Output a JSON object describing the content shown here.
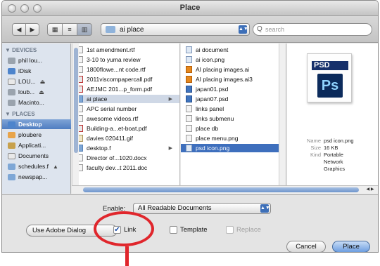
{
  "window": {
    "title": "Place"
  },
  "toolbar": {
    "back_glyph": "◀",
    "forward_glyph": "▶",
    "view_icon_glyph": "▦",
    "view_list_glyph": "≡",
    "view_column_glyph": "▥",
    "path_label": "ai place",
    "search_placeholder": "search",
    "search_glyph": "Q"
  },
  "sidebar": {
    "devices_heading": "▼ DEVICES",
    "places_heading": "▼ PLACES",
    "devices": [
      {
        "label": "phil lou...",
        "icon": "hard-drive-icon",
        "eject": ""
      },
      {
        "label": "iDisk",
        "icon": "idisk-icon",
        "eject": ""
      },
      {
        "label": "LOU...",
        "icon": "drive-icon",
        "eject": "⏏"
      },
      {
        "label": "loub...",
        "icon": "drive-icon",
        "eject": "⏏"
      },
      {
        "label": "Macinto...",
        "icon": "hard-drive-icon",
        "eject": ""
      }
    ],
    "places": [
      {
        "label": "Desktop",
        "icon": "desktop-icon",
        "selected": true
      },
      {
        "label": "ploubere",
        "icon": "home-icon"
      },
      {
        "label": "Applicati...",
        "icon": "applications-icon"
      },
      {
        "label": "Documents",
        "icon": "documents-icon"
      },
      {
        "label": "schedules.f",
        "icon": "folder-icon",
        "eject": "▲"
      },
      {
        "label": "newspap...",
        "icon": "folder-icon"
      }
    ]
  },
  "column1": {
    "items": [
      {
        "label": "1st amendment.rtf",
        "icon": "file-icon"
      },
      {
        "label": "3-10 to yuma review",
        "icon": "file-icon"
      },
      {
        "label": "1800flowe...nt code.rtf",
        "icon": "file-icon"
      },
      {
        "label": "2011viscompapercall.pdf",
        "icon": "pdf-icon"
      },
      {
        "label": "AEJMC 201...p_form.pdf",
        "icon": "pdf-icon"
      },
      {
        "label": "ai place",
        "icon": "folder-icon",
        "chevron": "▶",
        "highlight": true
      },
      {
        "label": "APC serial number",
        "icon": "file-icon"
      },
      {
        "label": "awesome videos.rtf",
        "icon": "file-icon"
      },
      {
        "label": "Building-a...et-boat.pdf",
        "icon": "pdf-icon"
      },
      {
        "label": "davies 020411.gif",
        "icon": "gif-icon"
      },
      {
        "label": "desktop.f",
        "icon": "folder-icon",
        "chevron": "▶"
      },
      {
        "label": "Director of...1020.docx",
        "icon": "file-icon"
      },
      {
        "label": "faculty dev...t 2011.doc",
        "icon": "file-icon"
      }
    ]
  },
  "column2": {
    "items": [
      {
        "label": "ai document",
        "icon": "png-icon"
      },
      {
        "label": "ai icon.png",
        "icon": "png-icon"
      },
      {
        "label": "AI placing images.ai",
        "icon": "ai-icon"
      },
      {
        "label": "AI placing images.ai3",
        "icon": "ai-icon"
      },
      {
        "label": "japan01.psd",
        "icon": "psd-icon"
      },
      {
        "label": "japan07.psd",
        "icon": "psd-icon"
      },
      {
        "label": "links panel",
        "icon": "file-icon"
      },
      {
        "label": "links submenu",
        "icon": "file-icon"
      },
      {
        "label": "place db",
        "icon": "file-icon"
      },
      {
        "label": "place menu.png",
        "icon": "file-icon"
      },
      {
        "label": "psd icon.png",
        "icon": "png-icon",
        "selected": true
      }
    ]
  },
  "preview": {
    "icon_banner": "PSD",
    "icon_logo": "Ps",
    "meta": [
      {
        "key": "Name",
        "value": "psd icon.png"
      },
      {
        "key": "Size",
        "value": "16 KB"
      },
      {
        "key": "Kind",
        "value": "Portable"
      },
      {
        "key": "",
        "value": "Network"
      },
      {
        "key": "",
        "value": "Graphics"
      }
    ]
  },
  "hscroll": {
    "arrows": "◀ ▶"
  },
  "options": {
    "enable_label": "Enable:",
    "enable_value": "All Readable Documents",
    "adobe_dialog_label": "Use Adobe Dialog",
    "link_label": "Link",
    "link_checked": true,
    "check_glyph": "✔",
    "template_label": "Template",
    "template_checked": false,
    "replace_label": "Replace",
    "replace_disabled": true,
    "cancel_label": "Cancel",
    "place_label": "Place"
  },
  "colors": {
    "selection_blue": "#3e6fbd",
    "callout_red": "#e0262c",
    "primary_button": "#6c9ee0"
  }
}
